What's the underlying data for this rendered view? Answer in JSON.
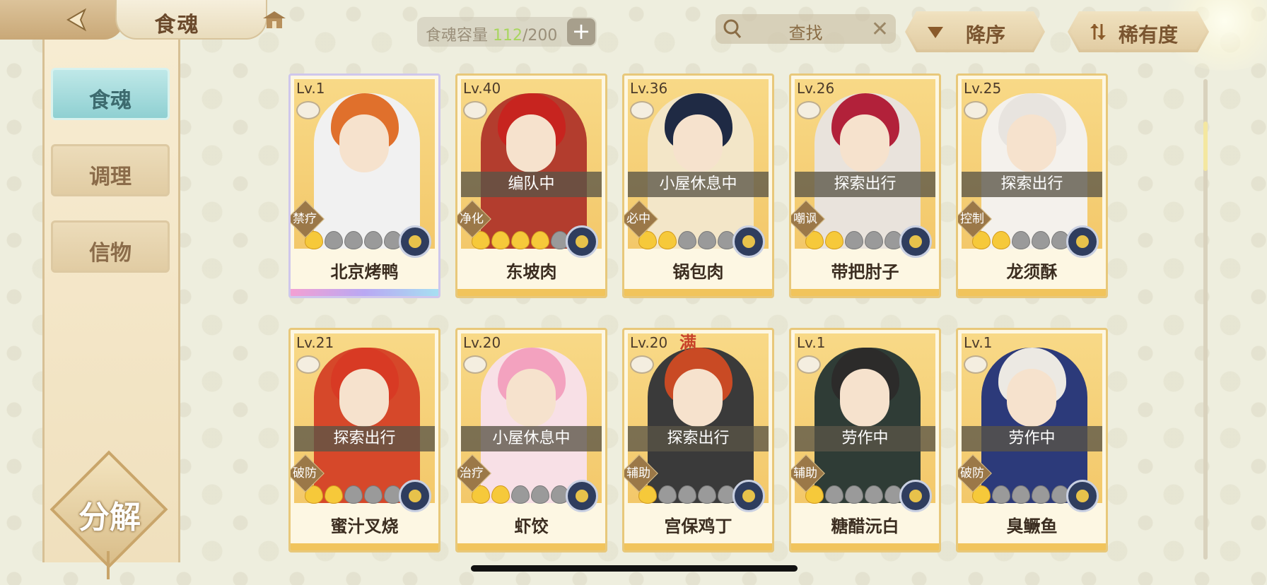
{
  "header": {
    "title": "食魂",
    "capacity_label": "食魂容量",
    "capacity_current": "112",
    "capacity_total": "/200",
    "search_text": "查找",
    "sort_order_label": "降序",
    "sort_by_label": "稀有度"
  },
  "sidebar": {
    "tabs": [
      {
        "label": "食魂",
        "active": true
      },
      {
        "label": "调理",
        "active": false
      },
      {
        "label": "信物",
        "active": false
      }
    ],
    "decompose_label": "分解"
  },
  "cards": [
    {
      "level": "Lv.1",
      "status": "",
      "role": "禁疗",
      "stars_on": 1,
      "stars_total": 5,
      "name": "北京烤鸭",
      "full": ""
    },
    {
      "level": "Lv.40",
      "status": "编队中",
      "role": "净化",
      "stars_on": 4,
      "stars_total": 6,
      "name": "东坡肉",
      "full": ""
    },
    {
      "level": "Lv.36",
      "status": "小屋休息中",
      "role": "必中",
      "stars_on": 2,
      "stars_total": 6,
      "name": "锅包肉",
      "full": ""
    },
    {
      "level": "Lv.26",
      "status": "探索出行",
      "role": "嘲讽",
      "stars_on": 2,
      "stars_total": 6,
      "name": "带把肘子",
      "full": ""
    },
    {
      "level": "Lv.25",
      "status": "探索出行",
      "role": "控制",
      "stars_on": 2,
      "stars_total": 5,
      "name": "龙须酥",
      "full": ""
    },
    {
      "level": "Lv.21",
      "status": "探索出行",
      "role": "破防",
      "stars_on": 2,
      "stars_total": 5,
      "name": "蜜汁叉烧",
      "full": ""
    },
    {
      "level": "Lv.20",
      "status": "小屋休息中",
      "role": "治疗",
      "stars_on": 2,
      "stars_total": 6,
      "name": "虾饺",
      "full": ""
    },
    {
      "level": "Lv.20",
      "status": "探索出行",
      "role": "辅助",
      "stars_on": 1,
      "stars_total": 6,
      "name": "宫保鸡丁",
      "full": "满"
    },
    {
      "level": "Lv.1",
      "status": "劳作中",
      "role": "辅助",
      "stars_on": 1,
      "stars_total": 6,
      "name": "糖醋沅白",
      "full": ""
    },
    {
      "level": "Lv.1",
      "status": "劳作中",
      "role": "破防",
      "stars_on": 1,
      "stars_total": 5,
      "name": "臭鳜鱼",
      "full": ""
    }
  ],
  "colors": {
    "hair": [
      "#e0702c",
      "#c7241f",
      "#1f2a44",
      "#b2213a",
      "#e8e4df",
      "#d83a24",
      "#f3a2bf",
      "#c94a24",
      "#2c2b2a",
      "#ece9e3"
    ],
    "outfit": [
      "#f1f1f1",
      "#b33d2e",
      "#f3e6c8",
      "#e9e3dc",
      "#f4f1ec",
      "#d6482a",
      "#f8e0e6",
      "#3a3a3a",
      "#2f3c36",
      "#2c3a7a"
    ]
  }
}
